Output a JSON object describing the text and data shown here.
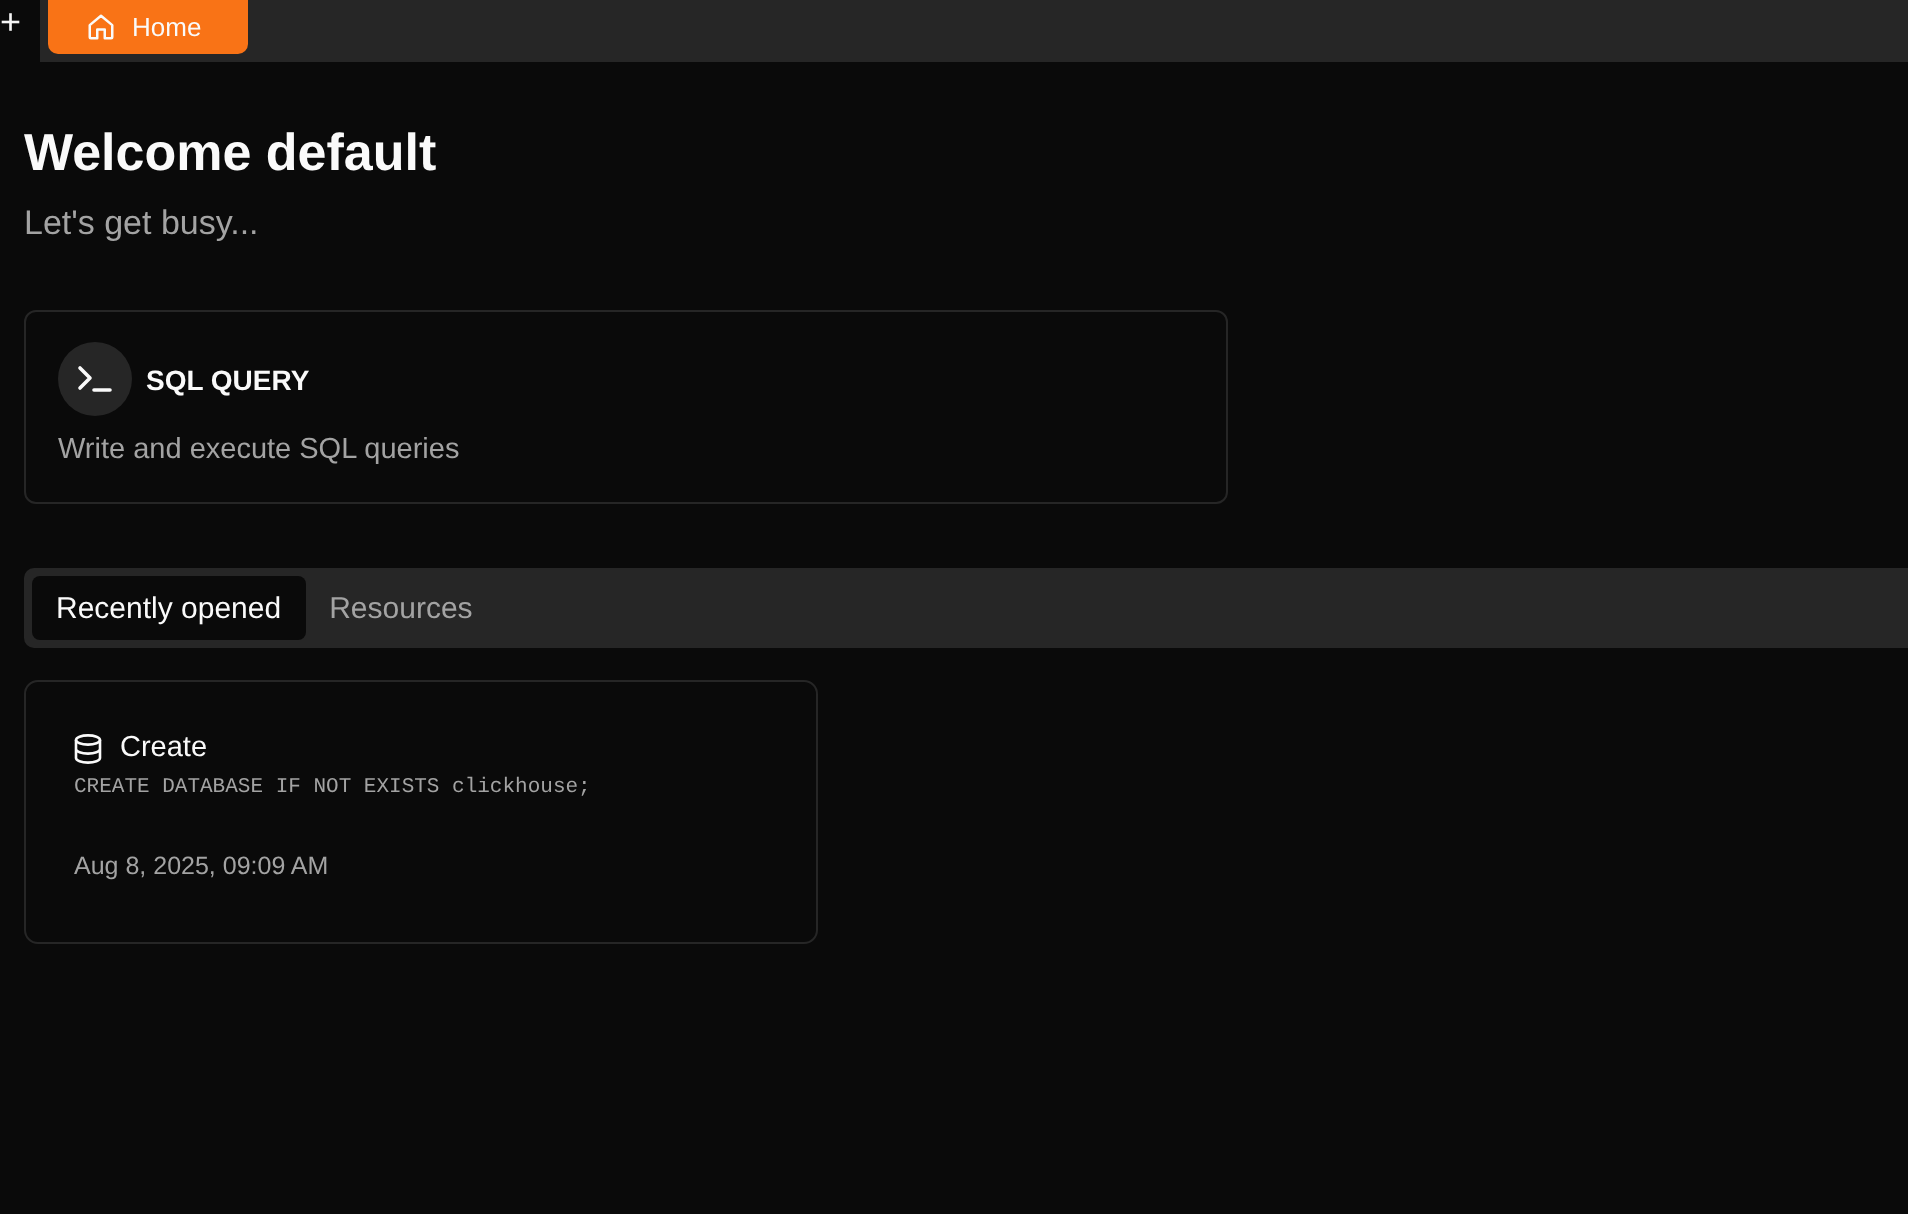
{
  "tab_bar": {
    "add_label": "+",
    "tabs": [
      {
        "label": "Home",
        "selected": true
      }
    ]
  },
  "welcome": {
    "title": "Welcome default",
    "subtitle": "Let's get busy..."
  },
  "actions": [
    {
      "title": "SQL QUERY",
      "description": "Write and execute SQL queries"
    }
  ],
  "section_tabs": [
    {
      "label": "Recently opened",
      "selected": true
    },
    {
      "label": "Resources",
      "selected": false
    }
  ],
  "recent": [
    {
      "title": "Create",
      "query": "CREATE DATABASE IF NOT EXISTS clickhouse;",
      "opened": "Aug 8, 2025, 09:09 AM"
    }
  ]
}
